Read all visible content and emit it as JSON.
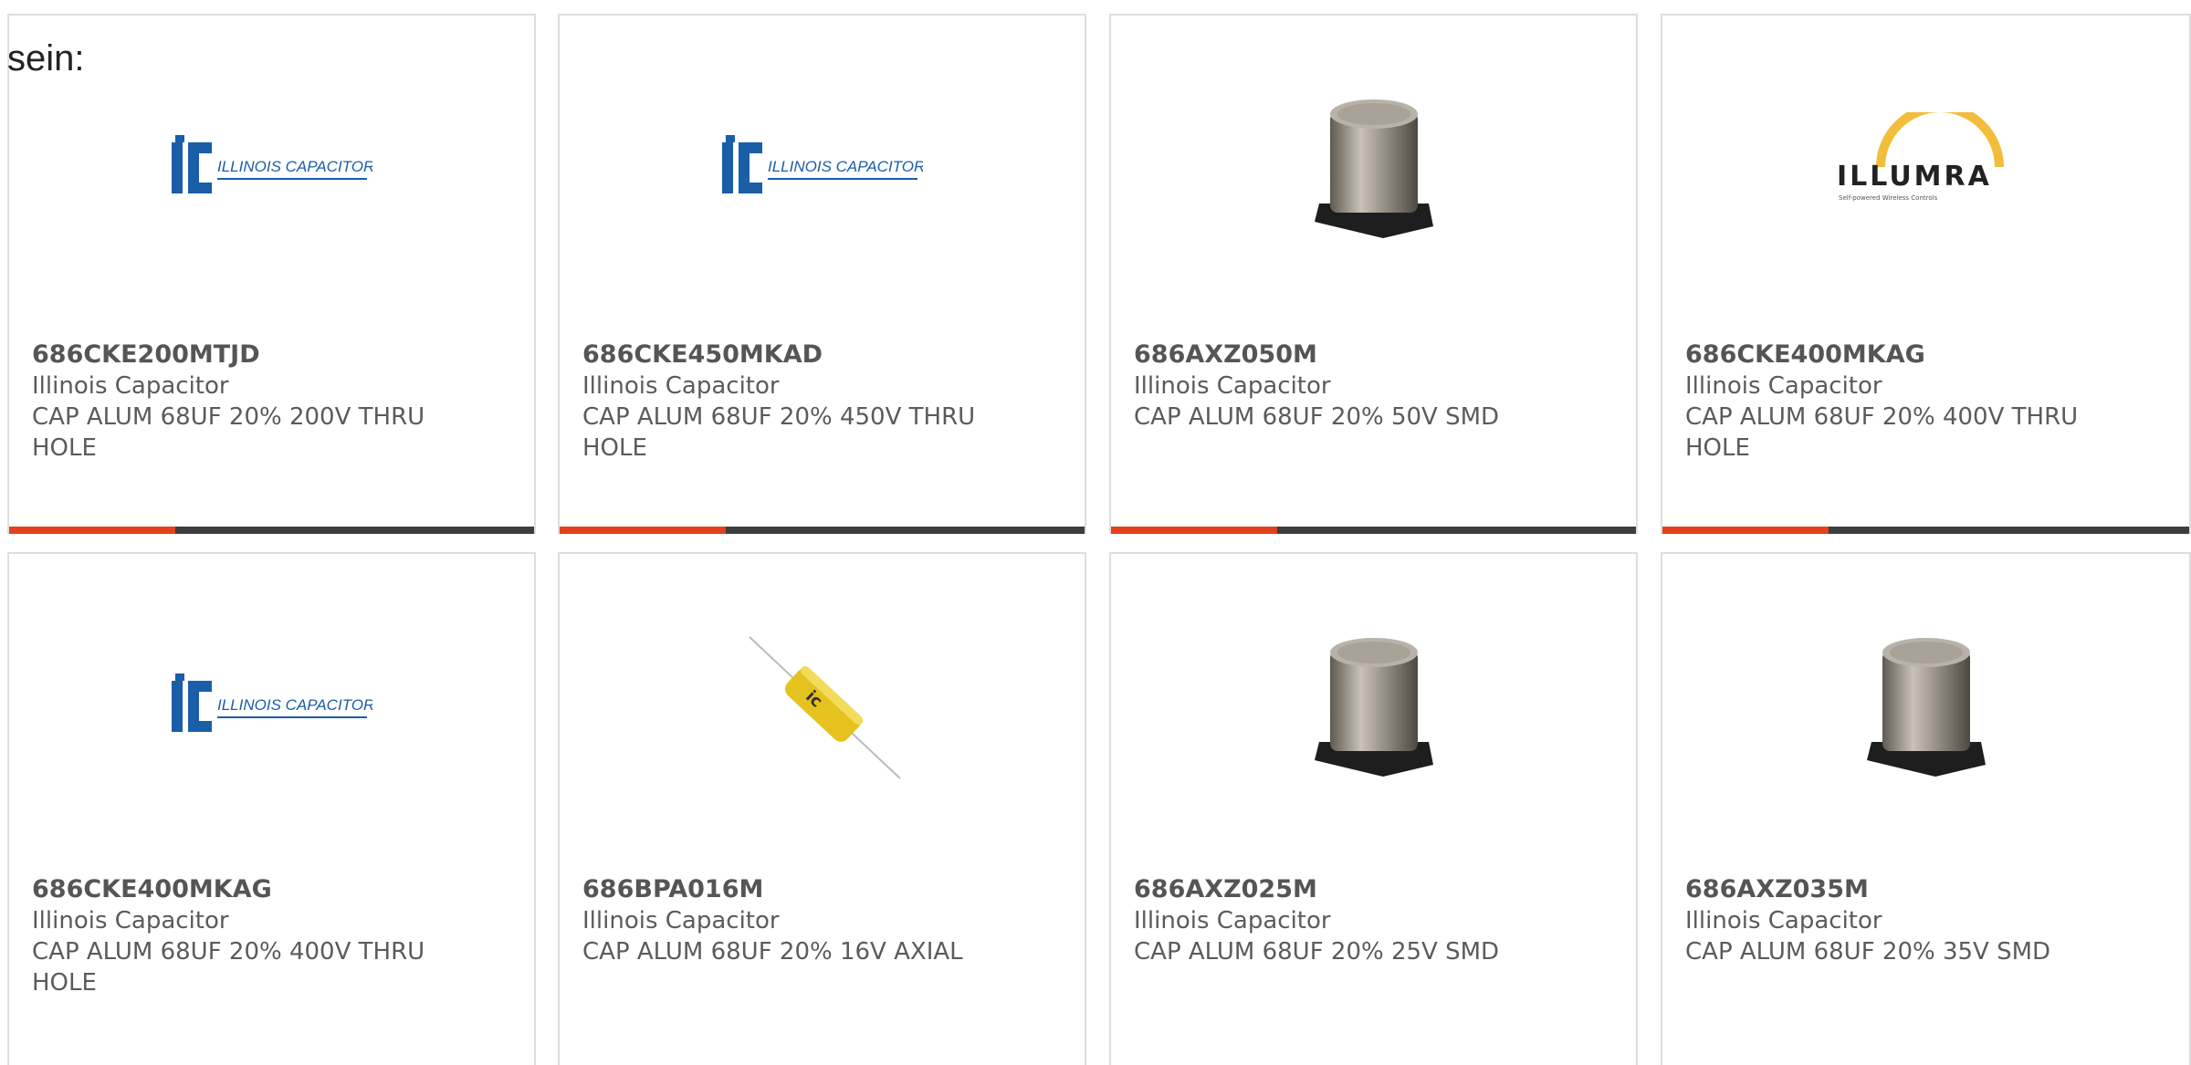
{
  "intro_text": "sein:",
  "colors": {
    "accent": "#e5401b",
    "bar": "#3d3d3d",
    "border": "#dedede"
  },
  "products": [
    {
      "part": "686CKE200MTJD",
      "manufacturer": "Illinois Capacitor",
      "description": "CAP ALUM 68UF 20% 200V THRU HOLE",
      "image": "ic-logo",
      "logo_text": "ILLINOIS CAPACITOR, INC."
    },
    {
      "part": "686CKE450MKAD",
      "manufacturer": "Illinois Capacitor",
      "description": "CAP ALUM 68UF 20% 450V THRU HOLE",
      "image": "ic-logo",
      "logo_text": "ILLINOIS CAPACITOR, INC."
    },
    {
      "part": "686AXZ050M",
      "manufacturer": "Illinois Capacitor",
      "description": "CAP ALUM 68UF 20% 50V SMD",
      "image": "smd-capacitor"
    },
    {
      "part": "686CKE400MKAG",
      "manufacturer": "Illinois Capacitor",
      "description": "CAP ALUM 68UF 20% 400V THRU HOLE",
      "image": "illumra-logo",
      "logo_text": "ILLUMRA",
      "logo_sub": "Self-powered Wireless Controls"
    },
    {
      "part": "686CKE400MKAG",
      "manufacturer": "Illinois Capacitor",
      "description": "CAP ALUM 68UF 20% 400V THRU HOLE",
      "image": "ic-logo",
      "logo_text": "ILLINOIS CAPACITOR, INC."
    },
    {
      "part": "686BPA016M",
      "manufacturer": "Illinois Capacitor",
      "description": "CAP ALUM 68UF 20% 16V AXIAL",
      "image": "axial-capacitor"
    },
    {
      "part": "686AXZ025M",
      "manufacturer": "Illinois Capacitor",
      "description": "CAP ALUM 68UF 20% 25V SMD",
      "image": "smd-capacitor"
    },
    {
      "part": "686AXZ035M",
      "manufacturer": "Illinois Capacitor",
      "description": "CAP ALUM 68UF 20% 35V SMD",
      "image": "smd-capacitor"
    }
  ]
}
